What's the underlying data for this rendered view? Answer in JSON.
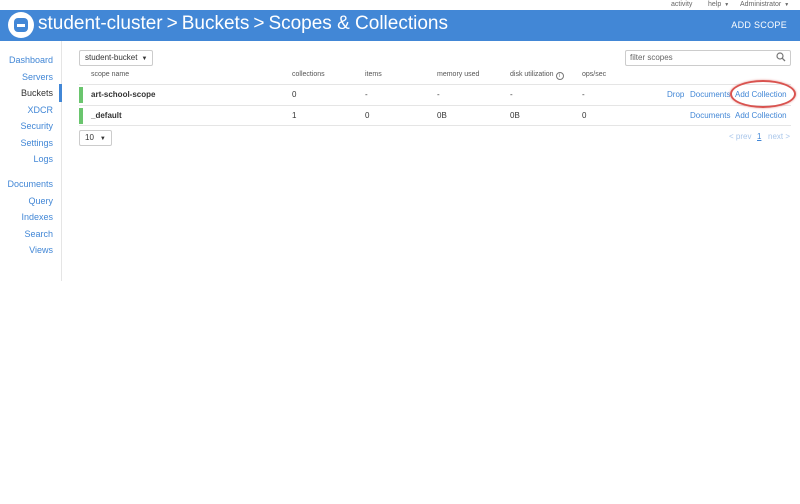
{
  "topbar": {
    "activity": "activity",
    "help": "help",
    "user": "Administrator"
  },
  "header": {
    "cluster": "student-cluster",
    "crumb1": "Buckets",
    "crumb2": "Scopes & Collections",
    "add_scope": "ADD SCOPE",
    "separator": ">"
  },
  "sidebar": {
    "dashboard": "Dashboard",
    "servers": "Servers",
    "buckets": "Buckets",
    "xdcr": "XDCR",
    "security": "Security",
    "settings": "Settings",
    "logs": "Logs",
    "documents": "Documents",
    "query": "Query",
    "indexes": "Indexes",
    "search": "Search",
    "views": "Views"
  },
  "toolbar": {
    "bucket_selected": "student-bucket",
    "filter_placeholder": "filter scopes"
  },
  "table": {
    "headers": {
      "scope_name": "scope name",
      "collections": "collections",
      "items": "items",
      "memory_used": "memory used",
      "disk_utilization": "disk utilization",
      "ops_sec": "ops/sec"
    },
    "rows": [
      {
        "name": "art-school-scope",
        "collections": "0",
        "items": "-",
        "memory": "-",
        "disk": "-",
        "ops": "-",
        "drop": "Drop",
        "documents": "Documents",
        "add_collection": "Add Collection"
      },
      {
        "name": "_default",
        "collections": "1",
        "items": "0",
        "memory": "0B",
        "disk": "0B",
        "ops": "0",
        "documents": "Documents",
        "add_collection": "Add Collection"
      }
    ]
  },
  "pagination": {
    "page_size": "10",
    "prev": "< prev",
    "current": "1",
    "next": "next >"
  },
  "colors": {
    "brand": "#4287d6",
    "status_green": "#6ac56e",
    "highlight_red": "#d9534f"
  }
}
